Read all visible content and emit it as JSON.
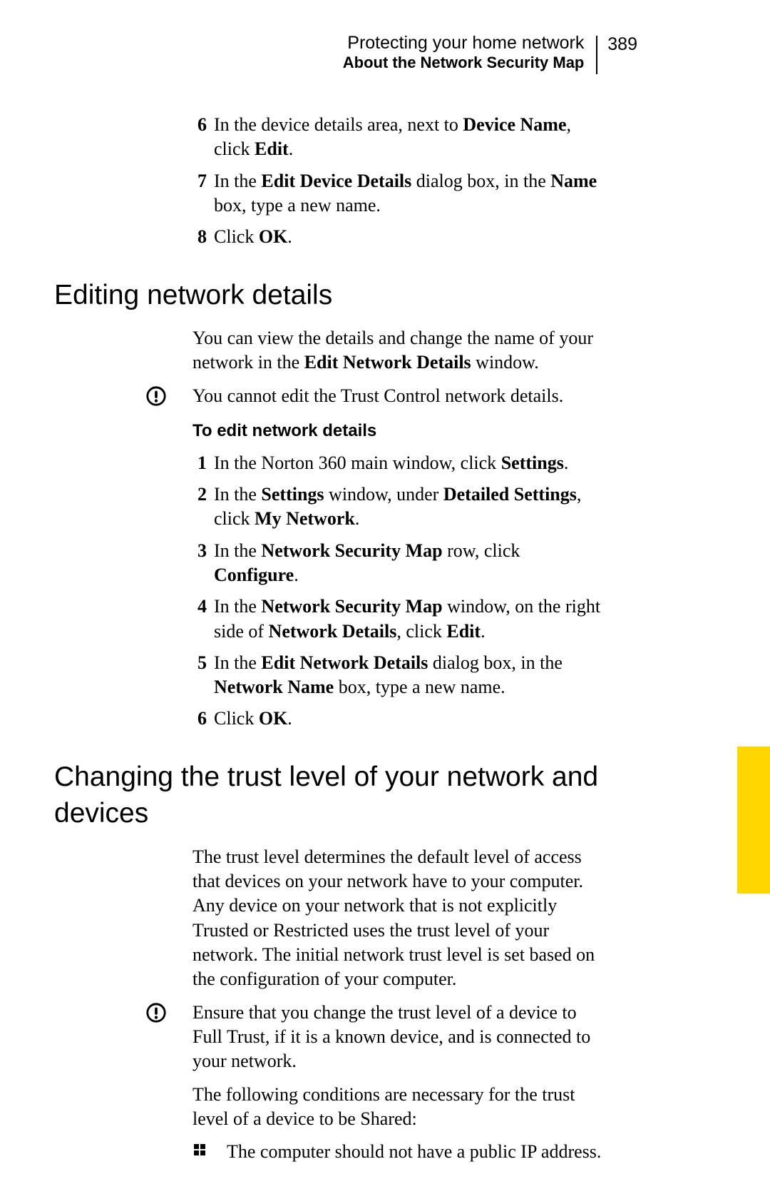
{
  "header": {
    "chapter": "Protecting your home network",
    "page_number": "389",
    "section": "About the Network Security Map"
  },
  "top_steps": [
    {
      "n": "6",
      "parts": [
        "In the device details area, next to ",
        {
          "b": "Device Name"
        },
        ", click ",
        {
          "b": "Edit"
        },
        "."
      ]
    },
    {
      "n": "7",
      "parts": [
        "In the ",
        {
          "b": "Edit Device Details"
        },
        " dialog box, in the ",
        {
          "b": "Name"
        },
        " box, type a new name."
      ]
    },
    {
      "n": "8",
      "parts": [
        "Click ",
        {
          "b": "OK"
        },
        "."
      ]
    }
  ],
  "h2a": "Editing network details",
  "p1": {
    "parts": [
      "You can view the details and change the name of your network in the ",
      {
        "b": "Edit Network Details"
      },
      " window."
    ]
  },
  "note1": "You cannot edit the Trust Control network details.",
  "proc1_title": "To edit network details",
  "proc1_steps": [
    {
      "n": "1",
      "parts": [
        "In the Norton 360 main window, click ",
        {
          "b": "Settings"
        },
        "."
      ]
    },
    {
      "n": "2",
      "parts": [
        "In the ",
        {
          "b": "Settings"
        },
        " window, under ",
        {
          "b": "Detailed Settings"
        },
        ", click ",
        {
          "b": "My Network"
        },
        "."
      ]
    },
    {
      "n": "3",
      "parts": [
        "In the ",
        {
          "b": "Network Security Map"
        },
        " row, click ",
        {
          "b": "Configure"
        },
        "."
      ]
    },
    {
      "n": "4",
      "parts": [
        "In the ",
        {
          "b": "Network Security Map"
        },
        " window, on the right side of ",
        {
          "b": "Network Details"
        },
        ", click ",
        {
          "b": "Edit"
        },
        "."
      ]
    },
    {
      "n": "5",
      "parts": [
        "In the ",
        {
          "b": "Edit Network Details"
        },
        " dialog box, in the ",
        {
          "b": "Network Name"
        },
        " box, type a new name."
      ]
    },
    {
      "n": "6",
      "parts": [
        "Click ",
        {
          "b": "OK"
        },
        "."
      ]
    }
  ],
  "h2b": "Changing the trust level of your network and devices",
  "p2": "The trust level determines the default level of access that devices on your network have to your computer. Any device on your network that is not explicitly Trusted or Restricted uses the trust level of your network. The initial network trust level is set based on the configuration of your computer.",
  "note2": "Ensure that you change the trust level of a device to Full Trust, if it is a known device, and is connected to your network.",
  "p3": "The following conditions are necessary for the trust level of a device to be Shared:",
  "bullet1": "The computer should not have a public IP address."
}
